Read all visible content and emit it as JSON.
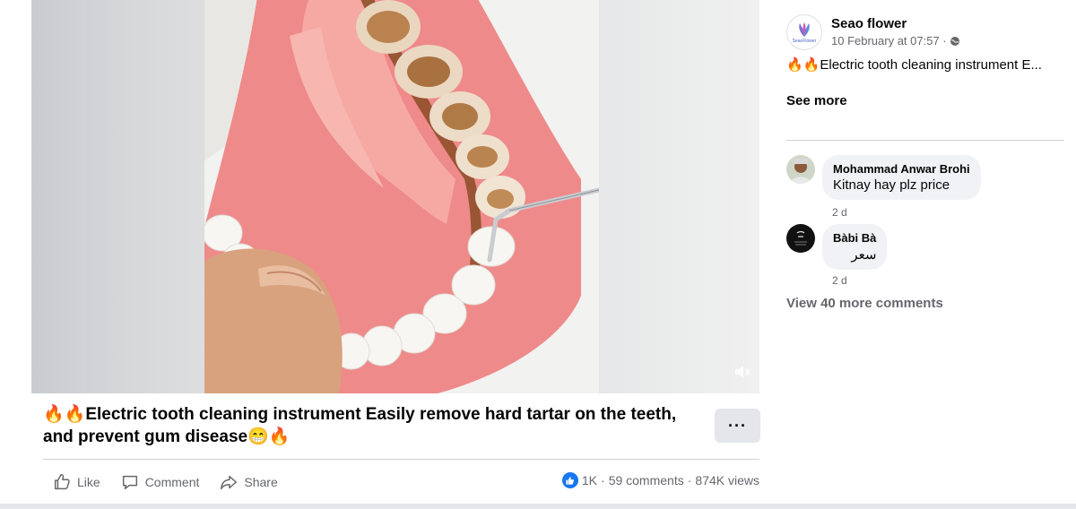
{
  "post": {
    "title": "🔥🔥Electric tooth cleaning instrument Easily remove hard tartar on the teeth, and prevent gum disease😁🔥",
    "more_label": "···"
  },
  "actions": {
    "like": "Like",
    "comment": "Comment",
    "share": "Share"
  },
  "stats": {
    "reactions": "1K",
    "sep1": "·",
    "comments": "59 comments",
    "sep2": "·",
    "views": "874K views"
  },
  "sidebar": {
    "author_name": "Seao flower",
    "avatar_text": "SeaoFlower",
    "timestamp": "10 February at 07:57 ·",
    "caption": "🔥🔥Electric tooth cleaning instrument E...",
    "see_more": "See more",
    "comments": [
      {
        "name": "Mohammad Anwar Brohi",
        "text": "Kitnay hay plz price",
        "time": "2 d"
      },
      {
        "name": "Bàbi Bà",
        "text": "سعر",
        "time": "2 d"
      }
    ],
    "view_more": "View 40 more comments"
  },
  "colors": {
    "gum": "#ef8a8a",
    "tooth": "#f7f4ef",
    "tartar": "#a5673a",
    "accent": "#1877f2",
    "muted": "#65676b"
  }
}
